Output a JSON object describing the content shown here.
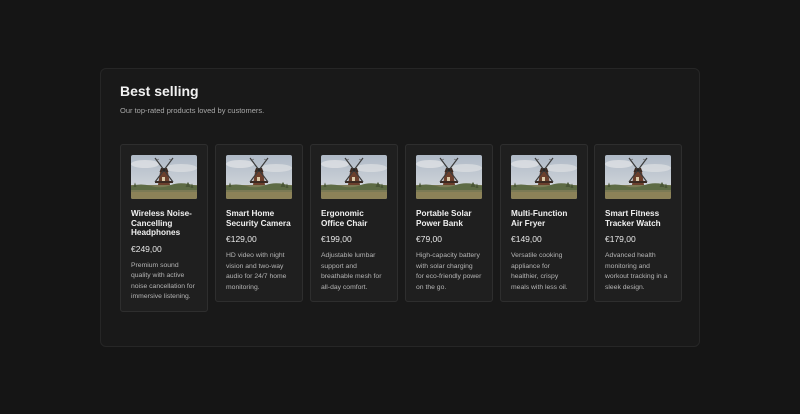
{
  "section": {
    "title": "Best selling",
    "subtitle": "Our top-rated products loved by customers."
  },
  "products": [
    {
      "name": "Wireless Noise-Cancelling Headphones",
      "price": "€249,00",
      "description": "Premium sound quality with active noise cancellation for immersive listening.",
      "image_icon": "windmill-photo"
    },
    {
      "name": "Smart Home Security Camera",
      "price": "€129,00",
      "description": "HD video with night vision and two-way audio for 24/7 home monitoring.",
      "image_icon": "windmill-photo"
    },
    {
      "name": "Ergonomic Office Chair",
      "price": "€199,00",
      "description": "Adjustable lumbar support and breathable mesh for all-day comfort.",
      "image_icon": "windmill-photo"
    },
    {
      "name": "Portable Solar Power Bank",
      "price": "€79,00",
      "description": "High-capacity battery with solar charging for eco-friendly power on the go.",
      "image_icon": "windmill-photo"
    },
    {
      "name": "Multi-Function Air Fryer",
      "price": "€149,00",
      "description": "Versatile cooking appliance for healthier, crispy meals with less oil.",
      "image_icon": "windmill-photo"
    },
    {
      "name": "Smart Fitness Tracker Watch",
      "price": "€179,00",
      "description": "Advanced health monitoring and workout tracking in a sleek design.",
      "image_icon": "windmill-photo"
    }
  ],
  "colors": {
    "background": "#151515",
    "panel": "#191919",
    "card": "#1f1f1f",
    "text": "#f0f0f0",
    "muted": "#a8a8a8"
  }
}
